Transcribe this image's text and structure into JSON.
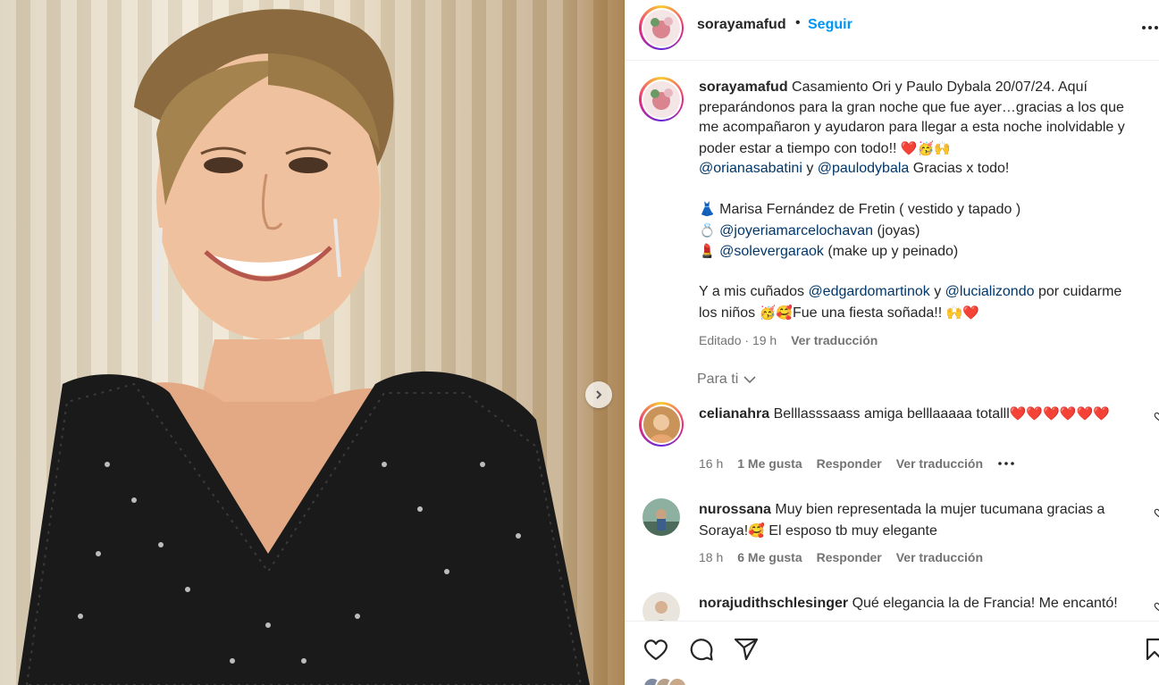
{
  "post": {
    "username": "sorayamafud",
    "follow_label": "Seguir",
    "caption": {
      "text_1": "Casamiento Ori y Paulo Dybala 20/07/24. Aquí preparándonos para la gran noche que fue ayer…gracias a los que me acompañaron y ayudaron para llegar a esta noche inolvidable y poder estar a tiempo con todo!! ",
      "emoji_1": "❤️🥳🙌",
      "mention_1": "@orianasabatini",
      "and_1": " y ",
      "mention_2": "@paulodybala",
      "text_2": " Gracias x todo!",
      "line_dress_emoji": "👗",
      "line_dress": " Marisa Fernández de Fretin ( vestido y tapado )",
      "line_ring_emoji": "💍",
      "mention_3": "@joyeriamarcelochavan",
      "line_ring_suffix": " (joyas)",
      "line_lips_emoji": "💄",
      "mention_4": "@solevergaraok",
      "line_lips_suffix": " (make up y peinado)",
      "text_3": "Y a mis cuñados ",
      "mention_5": "@edgardomartinok",
      "and_2": " y ",
      "mention_6": "@lucializondo",
      "text_4": " por cuidarme los niños ",
      "emoji_2": "🥳🥰",
      "text_5": "Fue una fiesta soñada!! ",
      "emoji_3": "🙌❤️"
    },
    "meta": {
      "edited": "Editado",
      "sep": " · ",
      "time": "19 h",
      "translate": "Ver traducción"
    }
  },
  "sort_label": "Para ti",
  "comments": [
    {
      "username": "celianahra",
      "text": " Belllasssaass amiga belllaaaaa totalll",
      "emoji": "❤️❤️❤️❤️❤️❤️",
      "time": "16 h",
      "likes": "1 Me gusta",
      "reply": "Responder",
      "translate": "Ver traducción"
    },
    {
      "username": "nurossana",
      "text": " Muy bien representada la mujer tucumana gracias a Soraya!",
      "emoji": "🥰",
      "text_after": " El esposo tb muy elegante",
      "time": "18 h",
      "likes": "6 Me gusta",
      "reply": "Responder",
      "translate": "Ver traducción"
    },
    {
      "username": "norajudithschlesinger",
      "text": " Qué elegancia la de Francia! Me encantó!"
    }
  ],
  "icons": {
    "like": "heart-icon",
    "comment": "comment-icon",
    "share": "paper-plane-icon",
    "save": "bookmark-icon",
    "more": "more-horizontal-icon",
    "next": "chevron-right-icon"
  },
  "colors": {
    "link": "#00376b",
    "follow": "#0095f6",
    "muted": "#737373"
  }
}
